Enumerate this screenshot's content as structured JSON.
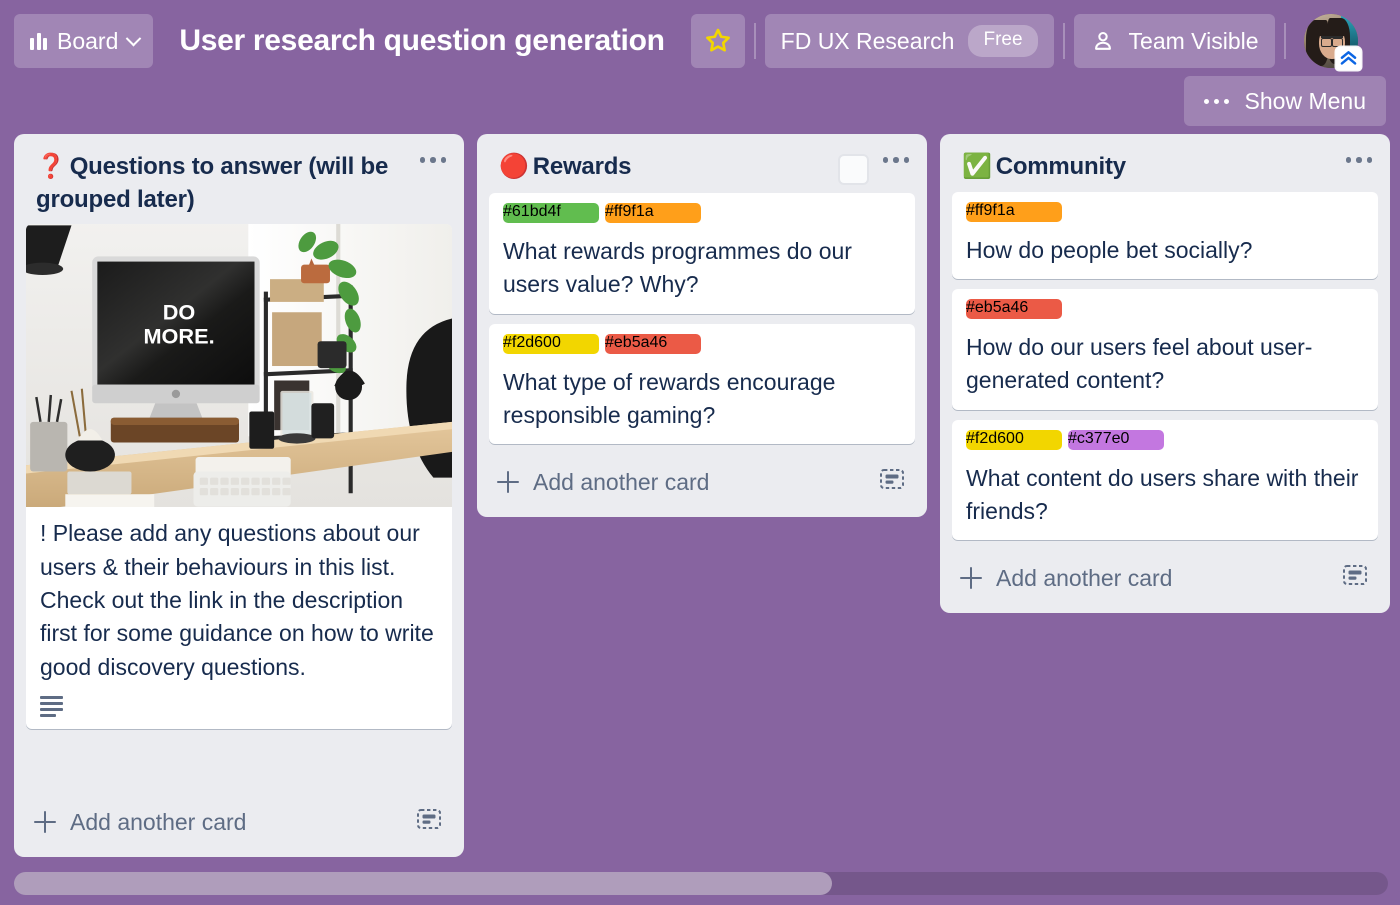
{
  "header": {
    "board_switcher_label": "Board",
    "board_switcher_icon": "board-columns-icon",
    "chevron_icon": "chevron-down-icon",
    "board_title": "User research question generation",
    "star_icon": "star-outline-icon",
    "workspace_name": "FD UX Research",
    "workspace_plan_badge": "Free",
    "visibility_icon": "person-icon",
    "visibility_label": "Team Visible",
    "avatar_name": "avatar",
    "avatar_badge_icon": "double-chevron-up-badge-icon"
  },
  "show_menu": {
    "icon": "ellipsis-icon",
    "label": "Show Menu"
  },
  "colors": {
    "board_background": "#8764a0",
    "list_background": "#ebecf0",
    "card_background": "#ffffff",
    "text_primary": "#172b4d",
    "text_muted": "#5e6c84",
    "header_button": "rgba(255,255,255,0.22)",
    "label_green": "#61bd4f",
    "label_orange": "#ff9f1a",
    "label_yellow": "#f2d600",
    "label_red": "#eb5a46",
    "label_purple": "#c377e0",
    "star_yellow": "#f2d600"
  },
  "lists": [
    {
      "emoji": "❓",
      "emoji_name": "red-question-mark-emoji",
      "title": "Questions to answer (will be grouped later)",
      "menu_icon": "list-actions-ellipsis-icon",
      "has_placeholder_square": false,
      "add_card_label": "Add another card",
      "add_card_plus_icon": "plus-icon",
      "template_icon": "card-template-icon",
      "has_scrollbar": true,
      "cards": [
        {
          "labels": [],
          "cover": "desk-workspace-photo",
          "cover_alt": "Desk with iMac displaying DO MORE., plants, shelves and keyboard",
          "cover_screen_text_line1": "DO",
          "cover_screen_text_line2": "MORE.",
          "text": "! Please add any questions about our users & their behaviours in this list. Check out the link in the description first for some guidance on how to write good discovery questions.",
          "badges": [
            "description-badge"
          ]
        }
      ]
    },
    {
      "emoji": "🔴",
      "emoji_name": "red-circle-emoji",
      "title": "Rewards",
      "menu_icon": "list-actions-ellipsis-icon",
      "has_placeholder_square": true,
      "add_card_label": "Add another card",
      "add_card_plus_icon": "plus-icon",
      "template_icon": "card-template-icon",
      "has_scrollbar": false,
      "cards": [
        {
          "labels": [
            "#61bd4f",
            "#ff9f1a"
          ],
          "cover": null,
          "text": "What rewards programmes do our users value? Why?",
          "badges": []
        },
        {
          "labels": [
            "#f2d600",
            "#eb5a46"
          ],
          "cover": null,
          "text": "What type of rewards encourage responsible gaming?",
          "badges": []
        }
      ]
    },
    {
      "emoji": "✅",
      "emoji_name": "white-check-mark-emoji",
      "title": "Community",
      "menu_icon": "list-actions-ellipsis-icon",
      "has_placeholder_square": false,
      "add_card_label": "Add another card",
      "add_card_plus_icon": "plus-icon",
      "template_icon": "card-template-icon",
      "has_scrollbar": false,
      "cards": [
        {
          "labels": [
            "#ff9f1a"
          ],
          "cover": null,
          "text": "How do people bet socially?",
          "badges": []
        },
        {
          "labels": [
            "#eb5a46"
          ],
          "cover": null,
          "text": "How do our users feel about user-generated content?",
          "badges": []
        },
        {
          "labels": [
            "#f2d600",
            "#c377e0"
          ],
          "cover": null,
          "text": "What content do users share with their friends?",
          "badges": []
        }
      ]
    }
  ],
  "board_scrollbar": {
    "name": "board-horizontal-scrollbar",
    "thumb_fraction": 0.595
  }
}
